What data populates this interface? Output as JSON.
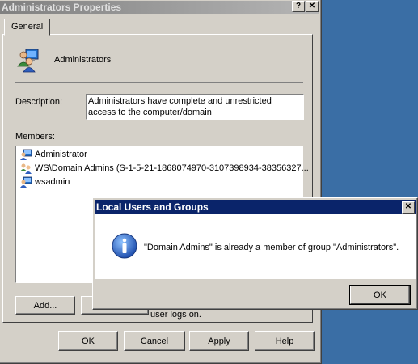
{
  "properties_window": {
    "title": "Administrators Properties",
    "help_btn": "?",
    "close_btn": "✕",
    "tab_general": "General",
    "group_name": "Administrators",
    "description_label": "Description:",
    "description_value": "Administrators have complete and unrestricted access to the computer/domain",
    "members_label": "Members:",
    "members": [
      {
        "name": "Administrator",
        "icon": "user-icon"
      },
      {
        "name": "WS\\Domain Admins (S-1-5-21-1868074970-3107398934-38356327...",
        "icon": "group-icon"
      },
      {
        "name": "wsadmin",
        "icon": "user-icon"
      }
    ],
    "add_label": "Add...",
    "hint_text": "user logs on.",
    "ok_label": "OK",
    "cancel_label": "Cancel",
    "apply_label": "Apply",
    "help_label": "Help"
  },
  "message_box": {
    "title": "Local Users and Groups",
    "close_btn": "✕",
    "icon": "info-icon",
    "message": "\"Domain Admins\" is already a member of group \"Administrators\".",
    "ok_label": "OK"
  },
  "colors": {
    "desktop": "#3a6ea5",
    "face": "#d4d0c8",
    "active_title": "#0a246a",
    "inactive_title": "#808080",
    "info_blue": "#1f5fbf"
  }
}
